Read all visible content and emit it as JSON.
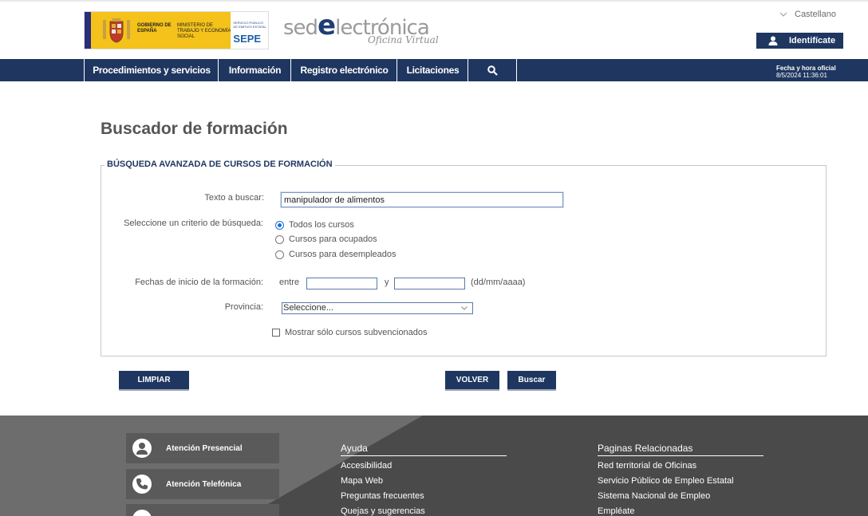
{
  "header": {
    "gov_text_1": "GOBIERNO DE ESPAÑA",
    "gov_text_2": "MINISTERIO DE TRABAJO Y ECONOMÍA SOCIAL",
    "sepe_small": "SERVICIO PÚBLICO DE EMPLEO ESTATAL",
    "sepe_label": "SEPE",
    "brand_pre": "sed",
    "brand_e": "e",
    "brand_post": "lectrónica",
    "brand_sub": "Oficina Virtual",
    "language": "Castellano",
    "login_label": "Identifícate"
  },
  "nav": {
    "items": [
      "Procedimientos y servicios",
      "Información",
      "Registro electrónico",
      "Licitaciones"
    ],
    "datetime_label": "Fecha y hora oficial",
    "datetime_value": "8/5/2024 11:36:01"
  },
  "page": {
    "title": "Buscador de formación",
    "legend": "BÚSQUEDA AVANZADA DE CURSOS DE FORMACIÓN"
  },
  "form": {
    "search_label": "Texto a buscar:",
    "search_value": "manipulador de alimentos",
    "criteria_label": "Seleccione un criterio de búsqueda:",
    "criteria_options": [
      "Todos los cursos",
      "Cursos para ocupados",
      "Cursos para desempleados"
    ],
    "criteria_selected": "Todos los cursos",
    "dates_label": "Fechas de inicio de la formación:",
    "between": "entre",
    "and": "y",
    "date_format": "(dd/mm/aaaa)",
    "province_label": "Provincia:",
    "province_value": "Seleccione...",
    "subsidized_label": "Mostrar sólo cursos subvencionados",
    "subsidized_checked": false
  },
  "buttons": {
    "clear": "LIMPIAR",
    "back": "VOLVER",
    "search": "Buscar"
  },
  "footer": {
    "boxes": [
      "Atención Presencial",
      "Atención Telefónica"
    ],
    "help_title": "Ayuda",
    "help_links": [
      "Accesibilidad",
      "Mapa Web",
      "Preguntas frecuentes",
      "Quejas y sugerencias"
    ],
    "related_title": "Paginas Relacionadas",
    "related_links": [
      "Red territorial de Oficinas",
      "Servicio Público de Empleo Estatal",
      "Sistema Nacional de Empleo",
      "Empléate"
    ]
  },
  "colors": {
    "primary": "#1f3760",
    "footer": "#6d6d6d"
  }
}
